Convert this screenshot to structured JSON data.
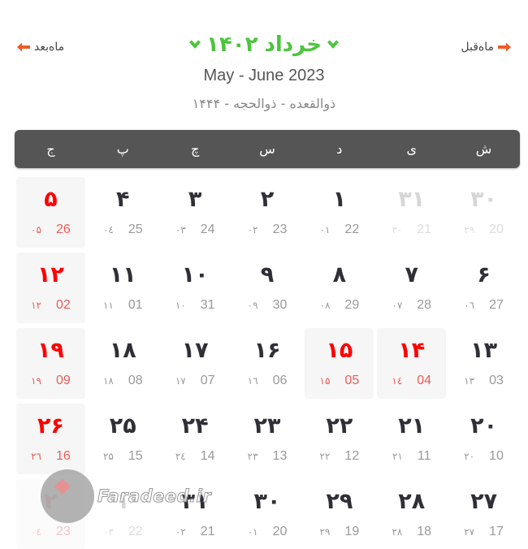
{
  "header": {
    "next_month_label": "ماه‌بعد",
    "prev_month_label": "ماه‌قبل",
    "month_label": "خرداد",
    "year_label": "۱۴۰۲",
    "gregorian_range": "May - June 2023",
    "hijri_range": "ذوالقعده - ذوالحجه - ۱۴۴۴",
    "accent_color": "#4cc53c",
    "arrow_color": "#f05a28"
  },
  "weekdays": [
    "ش",
    "ی",
    "د",
    "س",
    "چ",
    "پ",
    "ج"
  ],
  "weeks": [
    [
      {
        "persian": "۳۰",
        "greg": "20",
        "hijri": "۲۹",
        "other": true,
        "holiday": false
      },
      {
        "persian": "۳۱",
        "greg": "21",
        "hijri": "۳۰",
        "other": true,
        "holiday": false
      },
      {
        "persian": "۱",
        "greg": "22",
        "hijri": "۰۱",
        "other": false,
        "holiday": false
      },
      {
        "persian": "۲",
        "greg": "23",
        "hijri": "۰۲",
        "other": false,
        "holiday": false
      },
      {
        "persian": "۳",
        "greg": "24",
        "hijri": "۰۳",
        "other": false,
        "holiday": false
      },
      {
        "persian": "۴",
        "greg": "25",
        "hijri": "۰٤",
        "other": false,
        "holiday": false
      },
      {
        "persian": "۵",
        "greg": "26",
        "hijri": "۰۵",
        "other": false,
        "holiday": true
      }
    ],
    [
      {
        "persian": "۶",
        "greg": "27",
        "hijri": "۰٦",
        "other": false,
        "holiday": false
      },
      {
        "persian": "۷",
        "greg": "28",
        "hijri": "۰۷",
        "other": false,
        "holiday": false
      },
      {
        "persian": "۸",
        "greg": "29",
        "hijri": "۰۸",
        "other": false,
        "holiday": false
      },
      {
        "persian": "۹",
        "greg": "30",
        "hijri": "۰۹",
        "other": false,
        "holiday": false
      },
      {
        "persian": "۱۰",
        "greg": "31",
        "hijri": "۱۰",
        "other": false,
        "holiday": false
      },
      {
        "persian": "۱۱",
        "greg": "01",
        "hijri": "۱۱",
        "other": false,
        "holiday": false
      },
      {
        "persian": "۱۲",
        "greg": "02",
        "hijri": "۱۲",
        "other": false,
        "holiday": true
      }
    ],
    [
      {
        "persian": "۱۳",
        "greg": "03",
        "hijri": "۱۳",
        "other": false,
        "holiday": false
      },
      {
        "persian": "۱۴",
        "greg": "04",
        "hijri": "۱٤",
        "other": false,
        "holiday": true
      },
      {
        "persian": "۱۵",
        "greg": "05",
        "hijri": "۱۵",
        "other": false,
        "holiday": true
      },
      {
        "persian": "۱۶",
        "greg": "06",
        "hijri": "۱٦",
        "other": false,
        "holiday": false
      },
      {
        "persian": "۱۷",
        "greg": "07",
        "hijri": "۱۷",
        "other": false,
        "holiday": false
      },
      {
        "persian": "۱۸",
        "greg": "08",
        "hijri": "۱۸",
        "other": false,
        "holiday": false
      },
      {
        "persian": "۱۹",
        "greg": "09",
        "hijri": "۱۹",
        "other": false,
        "holiday": true
      }
    ],
    [
      {
        "persian": "۲۰",
        "greg": "10",
        "hijri": "۲۰",
        "other": false,
        "holiday": false
      },
      {
        "persian": "۲۱",
        "greg": "11",
        "hijri": "۲۱",
        "other": false,
        "holiday": false
      },
      {
        "persian": "۲۲",
        "greg": "12",
        "hijri": "۲۲",
        "other": false,
        "holiday": false
      },
      {
        "persian": "۲۳",
        "greg": "13",
        "hijri": "۲۳",
        "other": false,
        "holiday": false
      },
      {
        "persian": "۲۴",
        "greg": "14",
        "hijri": "۲٤",
        "other": false,
        "holiday": false
      },
      {
        "persian": "۲۵",
        "greg": "15",
        "hijri": "۲۵",
        "other": false,
        "holiday": false
      },
      {
        "persian": "۲۶",
        "greg": "16",
        "hijri": "۲٦",
        "other": false,
        "holiday": true
      }
    ],
    [
      {
        "persian": "۲۷",
        "greg": "17",
        "hijri": "۲۷",
        "other": false,
        "holiday": false
      },
      {
        "persian": "۲۸",
        "greg": "18",
        "hijri": "۲۸",
        "other": false,
        "holiday": false
      },
      {
        "persian": "۲۹",
        "greg": "19",
        "hijri": "۲۹",
        "other": false,
        "holiday": false
      },
      {
        "persian": "۳۰",
        "greg": "20",
        "hijri": "۰۱",
        "other": false,
        "holiday": false
      },
      {
        "persian": "۳۱",
        "greg": "21",
        "hijri": "۰۲",
        "other": false,
        "holiday": false
      },
      {
        "persian": "۱",
        "greg": "22",
        "hijri": "۰۳",
        "other": true,
        "holiday": false
      },
      {
        "persian": "۲",
        "greg": "23",
        "hijri": "۰٤",
        "other": true,
        "holiday": true
      }
    ]
  ],
  "watermark": {
    "text": "Faradeed.ir"
  }
}
